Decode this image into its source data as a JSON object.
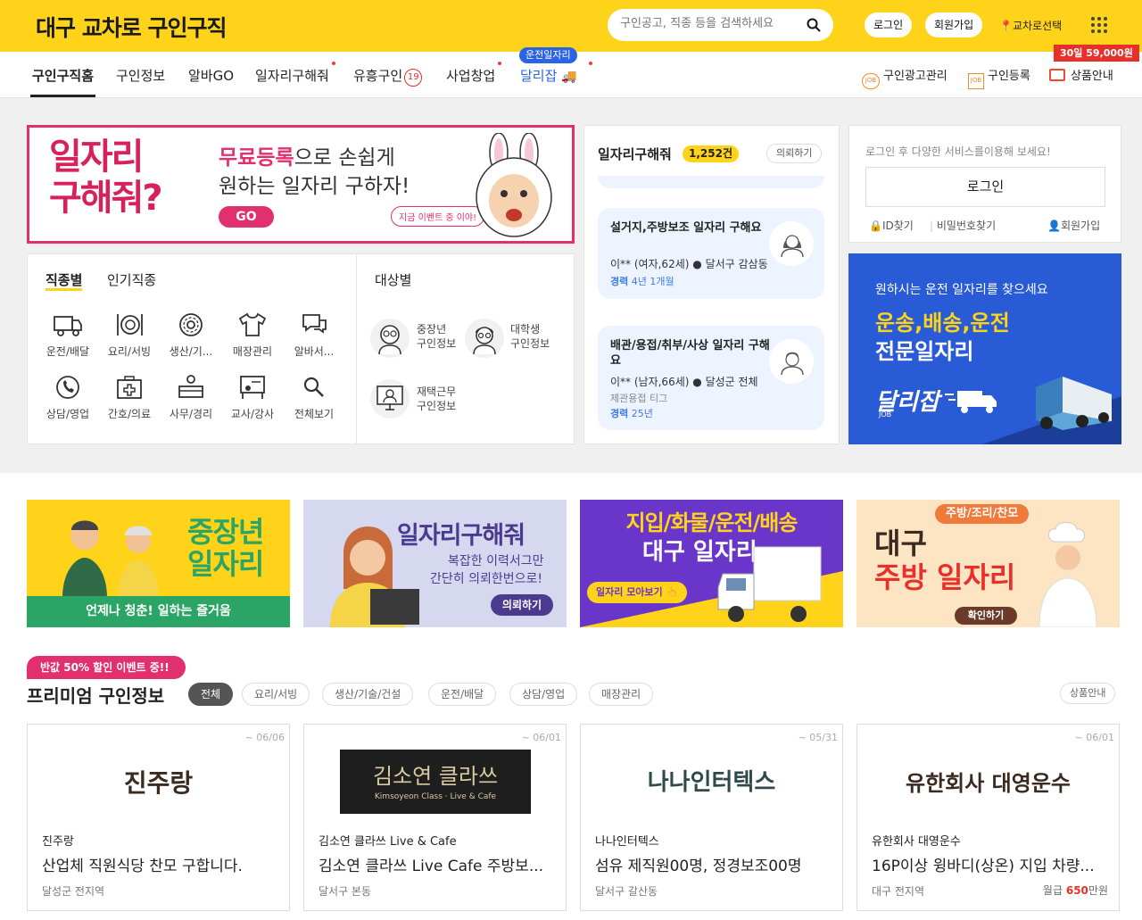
{
  "header": {
    "logo_prefix": "대구",
    "logo_main": "교차로",
    "logo_suffix": "구인구직",
    "search_placeholder": "구인공고, 직종 등을 검색하세요",
    "login": "로그인",
    "signup": "회원가입",
    "region": "교차로선택"
  },
  "nav": {
    "items": [
      "구인구직홈",
      "구인정보",
      "알바GO",
      "일자리구해줘",
      "유흥구인",
      "사업창업",
      "달리잡"
    ],
    "age_badge": "19",
    "driver_badge": "운전일자리",
    "price_badge": "30일 59,000원",
    "right": [
      "구인광고관리",
      "구인등록",
      "상품안내"
    ]
  },
  "hero": {
    "big_line1": "일자리",
    "big_line2": "구해줘?",
    "line1_highlight": "무료등록",
    "line1_rest": "으로 손쉽게",
    "line2": "원하는 일자리 구하자!",
    "go": "GO",
    "event": "지금 이벤트 중 이야!"
  },
  "categories": {
    "tab_active": "직종별",
    "tab_other": "인기직종",
    "items": [
      "운전/배달",
      "요리/서빙",
      "생산/기...",
      "매장관리",
      "알바서...",
      "상담/영업",
      "간호/의료",
      "사무/경리",
      "교사/강사",
      "전체보기"
    ],
    "target_title": "대상별",
    "targets": [
      {
        "l1": "중장년",
        "l2": "구인정보"
      },
      {
        "l1": "대학생",
        "l2": "구인정보"
      },
      {
        "l1": "재택근무",
        "l2": "구인정보"
      }
    ]
  },
  "requests": {
    "title": "일자리구해줘",
    "count": "1,252건",
    "request_btn": "의뢰하기",
    "items": [
      {
        "title": "설거지,주방보조 일자리 구해요",
        "who": "이** (여자,62세)",
        "loc": "달서구 감삼동",
        "exp_label": "경력",
        "exp": "4년 1개월",
        "extra": ""
      },
      {
        "title": "배관/용접/취부/사상 일자리 구해요",
        "who": "이** (남자,66세)",
        "loc": "달성군 전체",
        "exp_label": "경력",
        "exp": "25년",
        "extra": "제관용접 티그"
      }
    ]
  },
  "login_box": {
    "prompt": "로그인 후 다양한 서비스를이용해 보세요!",
    "login": "로그인",
    "find_id": "ID찾기",
    "find_pw": "비밀번호찾기",
    "signup": "회원가입"
  },
  "dalijob_ad": {
    "line1": "원하시는 운전 일자리를 찾으세요",
    "line2": "운송,배송,운전",
    "line3": "전문일자리",
    "brand": "달리잡",
    "brand_sub": "JOB"
  },
  "banners": [
    {
      "title1": "중장년",
      "title2": "일자리",
      "sub": "언제나 청춘! 일하는 즐거움"
    },
    {
      "title": "일자리구해줘",
      "sub1": "복잡한 이력서그만",
      "sub2": "간단히 의뢰한번으로!",
      "btn": "의뢰하기"
    },
    {
      "title1": "지입/화물/운전/배송",
      "title2": "대구 일자리",
      "btn": "일자리 모아보기"
    },
    {
      "tag": "주방/조리/찬모",
      "title1": "대구",
      "title2": "주방 일자리",
      "btn": "확인하기"
    }
  ],
  "premium": {
    "event": "반값 50% 할인 이벤트 중!!",
    "title": "프리미엄 구인정보",
    "tags": [
      "전체",
      "요리/서빙",
      "생산/기술/건설",
      "운전/배달",
      "상담/영업",
      "매장관리"
    ],
    "product_btn": "상품안내",
    "cards": [
      {
        "date": "~ 06/06",
        "logo": "진주랑",
        "company": "진주랑",
        "title": "산업체 직원식당 찬모 구합니다.",
        "loc": "달성군 전지역",
        "pay_label": "",
        "pay": ""
      },
      {
        "date": "~ 06/01",
        "logo": "김소연 클라쓰",
        "logo_sub": "Kimsoyeon Class · Live & Cafe",
        "company": "김소연 클라쓰 Live & Cafe",
        "title": "김소연 클라쓰 Live Cafe 주방보...",
        "loc": "달서구 본동",
        "pay_label": "",
        "pay": ""
      },
      {
        "date": "~ 05/31",
        "logo": "나나인터텍스",
        "company": "나나인터텍스",
        "title": "섬유 제직원00명, 정경보조00명",
        "loc": "달서구 갈산동",
        "pay_label": "",
        "pay": ""
      },
      {
        "date": "~ 06/01",
        "logo": "유한회사 대영운수",
        "company": "유한회사 대영운수",
        "title": "16P이상 윙바디(상온) 지입 차량...",
        "loc": "대구 전지역",
        "pay_label": "월급",
        "pay": "650",
        "pay_unit": "만원"
      }
    ]
  }
}
